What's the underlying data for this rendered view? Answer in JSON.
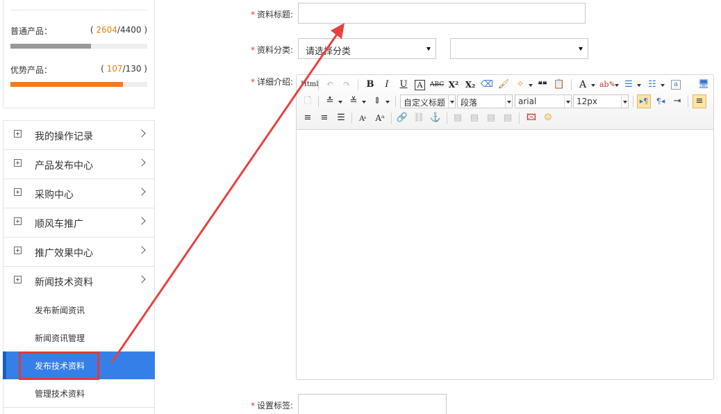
{
  "sidebar": {
    "quotas": [
      {
        "label": "普通产品：",
        "open": "( ",
        "used": "2604",
        "total": "/4400 )",
        "fraction": 0.59,
        "color": "#999999"
      },
      {
        "label": "优势产品：",
        "open": "( ",
        "used": "107",
        "total": "/130 )",
        "fraction": 0.82,
        "color": "#f07a1c"
      }
    ],
    "nav": [
      {
        "label": "我的操作记录"
      },
      {
        "label": "产品发布中心"
      },
      {
        "label": "采购中心"
      },
      {
        "label": "顺风车推广"
      },
      {
        "label": "推广效果中心"
      },
      {
        "label": "新闻技术资料"
      }
    ],
    "subnav": [
      {
        "label": "发布新闻资讯"
      },
      {
        "label": "新闻资讯管理"
      },
      {
        "label": "发布技术资料"
      },
      {
        "label": "管理技术资料"
      }
    ]
  },
  "form": {
    "required_mark": "*",
    "title_label": "资料标题:",
    "title_value": "",
    "category_label": "资料分类:",
    "category_select_1": "请选择分类",
    "category_select_2": "",
    "detail_label": "详细介绍:",
    "tags_label": "设置标签:",
    "tags_value": ""
  },
  "editor": {
    "toolbar": {
      "html": "Html",
      "bold": "B",
      "italic": "I",
      "underline": "U",
      "border_text": "A",
      "strike": "ABC",
      "superscript": "X²",
      "subscript": "X₂",
      "quote": "❝❝",
      "font_color": "A",
      "custom_heading": "自定义标题",
      "paragraph": "段落",
      "font_family": "arial",
      "font_size": "12px"
    }
  }
}
